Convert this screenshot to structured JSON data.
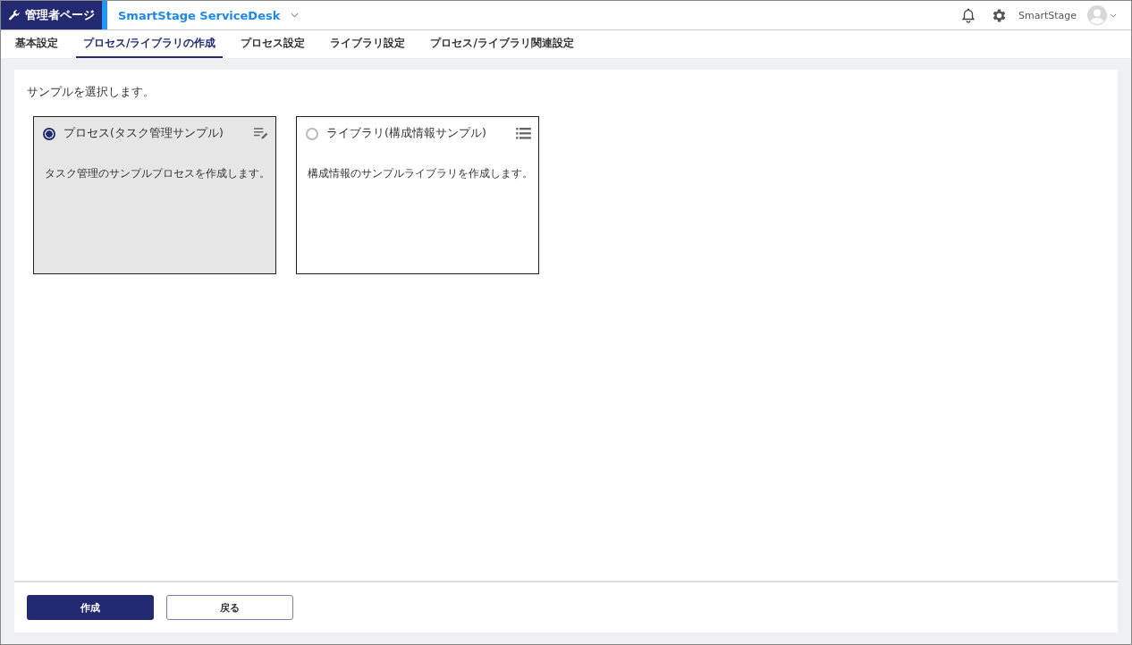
{
  "header": {
    "admin_badge": "管理者ページ",
    "app_name": "SmartStage ServiceDesk",
    "user_name": "SmartStage"
  },
  "tabs": [
    {
      "label": "基本設定",
      "selected": false
    },
    {
      "label": "プロセス/ライブラリの作成",
      "selected": true
    },
    {
      "label": "プロセス設定",
      "selected": false
    },
    {
      "label": "ライブラリ設定",
      "selected": false
    },
    {
      "label": "プロセス/ライブラリ関連設定",
      "selected": false
    }
  ],
  "prompt": "サンプルを選択します。",
  "samples": [
    {
      "kind": "process",
      "title": "プロセス(タスク管理サンプル)",
      "description": "タスク管理のサンプルプロセスを作成します。",
      "selected": true
    },
    {
      "kind": "library",
      "title": "ライブラリ(構成情報サンプル)",
      "description": "構成情報のサンプルライブラリを作成します。",
      "selected": false
    }
  ],
  "buttons": [
    {
      "kind": "primary",
      "label": "作成"
    },
    {
      "kind": "secondary",
      "label": "戻る"
    }
  ]
}
